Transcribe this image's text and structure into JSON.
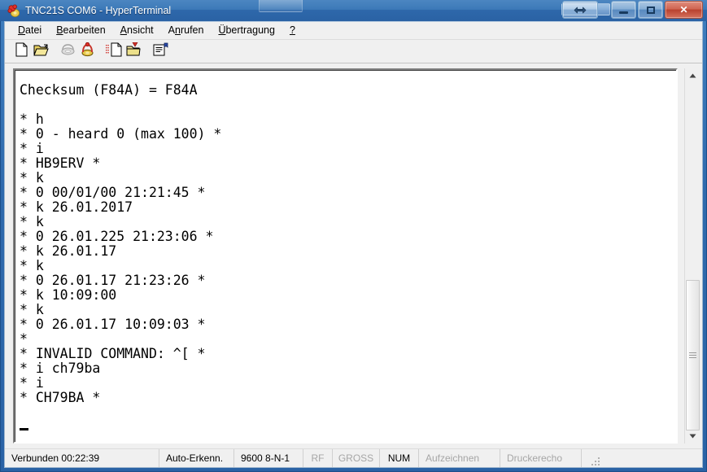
{
  "window": {
    "title": "TNC21S COM6 - HyperTerminal",
    "icon": "telephone-icon",
    "accent_blue": "#2f6aad",
    "close_red": "#c0392b"
  },
  "caption_buttons": [
    {
      "name": "restore-size-button",
      "glyph": "↔",
      "label": "Resize"
    },
    {
      "name": "minimize-button",
      "glyph": "–",
      "label": "Minimize"
    },
    {
      "name": "maximize-button",
      "glyph": "□",
      "label": "Maximize"
    },
    {
      "name": "close-button",
      "glyph": "✕",
      "label": "Close"
    }
  ],
  "menubar": [
    {
      "label": "Datei",
      "accel_index": 0
    },
    {
      "label": "Bearbeiten",
      "accel_index": 0
    },
    {
      "label": "Ansicht",
      "accel_index": 0
    },
    {
      "label": "Anrufen",
      "accel_index": 1
    },
    {
      "label": "Übertragung",
      "accel_index": 0
    },
    {
      "label": "?",
      "accel_index": -1
    }
  ],
  "toolbar": [
    {
      "name": "new-connection-icon",
      "label": "Neue Verbindung",
      "enabled": true
    },
    {
      "name": "open-folder-icon",
      "label": "Öffnen",
      "enabled": true
    },
    {
      "name": "disconnect-phone-icon",
      "label": "Trennen",
      "enabled": false
    },
    {
      "name": "connect-phone-icon",
      "label": "Anrufen",
      "enabled": true
    },
    {
      "name": "send-file-icon",
      "label": "Senden",
      "enabled": true
    },
    {
      "name": "receive-file-icon",
      "label": "Empfangen",
      "enabled": true
    },
    {
      "name": "properties-icon",
      "label": "Eigenschaften",
      "enabled": true
    }
  ],
  "terminal": {
    "lines": [
      "Checksum (F84A) = F84A",
      "",
      "* h",
      "* 0 - heard 0 (max 100) *",
      "* i",
      "* HB9ERV *",
      "* k",
      "* 0 00/01/00 21:21:45 *",
      "* k 26.01.2017",
      "* k",
      "* 0 26.01.225 21:23:06 *",
      "* k 26.01.17",
      "* k",
      "* 0 26.01.17 21:23:26 *",
      "* k 10:09:00",
      "* k",
      "* 0 26.01.17 10:09:03 *",
      "*",
      "* INVALID COMMAND: ^[ *",
      "* i ch79ba",
      "* i",
      "* CH79BA *",
      ""
    ],
    "cursor": "_"
  },
  "scrollbar": {
    "up_arrow": "▲",
    "down_arrow": "▼",
    "thumb_top_pct": 57,
    "thumb_height_pct": 43
  },
  "statusbar": {
    "connected": "Verbunden 00:22:39",
    "detect": "Auto-Erkenn.",
    "line_settings": "9600 8-N-1",
    "rf": "RF",
    "caps": "GROSS",
    "num": "NUM",
    "record": "Aufzeichnen",
    "printer_echo": "Druckerecho"
  }
}
